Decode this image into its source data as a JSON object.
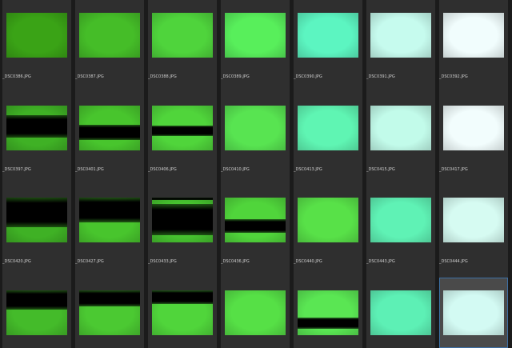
{
  "rows": [
    [
      {
        "file": "_DSC0386.JPG",
        "fill": "#3aa316",
        "bands": []
      },
      {
        "file": "_DSC0387.JPG",
        "fill": "#45bd28",
        "bands": []
      },
      {
        "file": "_DSC0388.JPG",
        "fill": "#4fd43c",
        "bands": []
      },
      {
        "file": "_DSC0389.JPG",
        "fill": "#58ef5b",
        "bands": []
      },
      {
        "file": "_DSC0390.JPG",
        "fill": "#5cf5c1",
        "bands": []
      },
      {
        "file": "_DSC0391.JPG",
        "fill": "#c6fbee",
        "bands": []
      },
      {
        "file": "_DSC0392.JPG",
        "fill": "#f1fdfd",
        "bands": []
      }
    ],
    [
      {
        "file": "_DSC0397.JPG",
        "fill": "#3fb125",
        "bands": [
          {
            "from": 0.22,
            "to": 0.72
          }
        ]
      },
      {
        "file": "_DSC0401.JPG",
        "fill": "#48c52d",
        "bands": [
          {
            "from": 0.42,
            "to": 0.76
          }
        ]
      },
      {
        "file": "_DSC0406.JPG",
        "fill": "#50d53b",
        "bands": [
          {
            "from": 0.45,
            "to": 0.68
          }
        ]
      },
      {
        "file": "_DSC0410.JPG",
        "fill": "#58e451",
        "bands": []
      },
      {
        "file": "_DSC0413.JPG",
        "fill": "#5ff5b3",
        "bands": []
      },
      {
        "file": "_DSC0415.JPG",
        "fill": "#c2fbea",
        "bands": []
      },
      {
        "file": "_DSC0417.JPG",
        "fill": "#f2fdfd",
        "bands": []
      }
    ],
    [
      {
        "file": "_DSC0420.JPG",
        "fill": "#3fb125",
        "bands": [
          {
            "from": 0.0,
            "to": 0.66
          }
        ]
      },
      {
        "file": "_DSC0427.JPG",
        "fill": "#48c52d",
        "bands": [
          {
            "from": 0.0,
            "to": 0.56
          }
        ]
      },
      {
        "file": "_DSC0433.JPG",
        "fill": "#46c22f",
        "bands": [
          {
            "from": 0.0,
            "to": 0.06
          },
          {
            "from": 0.14,
            "to": 0.84
          }
        ]
      },
      {
        "file": "_DSC0436.JPG",
        "fill": "#50d53b",
        "bands": [
          {
            "from": 0.48,
            "to": 0.78
          }
        ]
      },
      {
        "file": "_DSC0440.JPG",
        "fill": "#58e148",
        "bands": []
      },
      {
        "file": "_DSC0443.JPG",
        "fill": "#5ff2b5",
        "bands": []
      },
      {
        "file": "_DSC0444.JPG",
        "fill": "#d6fbf2",
        "bands": []
      }
    ],
    [
      {
        "file": "",
        "fill": "#44bb2a",
        "bands": [
          {
            "from": 0.0,
            "to": 0.42
          }
        ]
      },
      {
        "file": "",
        "fill": "#4bc932",
        "bands": [
          {
            "from": 0.0,
            "to": 0.36
          }
        ]
      },
      {
        "file": "",
        "fill": "#50d53b",
        "bands": [
          {
            "from": 0.0,
            "to": 0.3
          }
        ]
      },
      {
        "file": "",
        "fill": "#56e046",
        "bands": []
      },
      {
        "file": "",
        "fill": "#5ae653",
        "bands": [
          {
            "from": 0.6,
            "to": 0.86
          }
        ]
      },
      {
        "file": "",
        "fill": "#5df0b5",
        "bands": []
      },
      {
        "file": "",
        "fill": "#d3faf3",
        "bands": [],
        "selected": true
      }
    ]
  ],
  "colors": {
    "background": "#1b1b1b",
    "cell": "#2f2f2f",
    "cell_selected": "#4a4a4a",
    "selection_border": "#3d6fa3",
    "text": "#cfcfcf"
  }
}
